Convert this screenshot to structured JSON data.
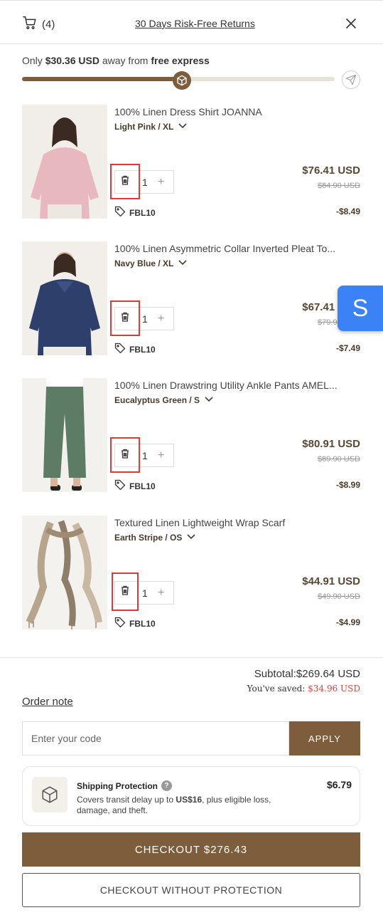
{
  "header": {
    "cart_count": "(4)",
    "returns_link": "30 Days Risk-Free Returns"
  },
  "shipping": {
    "prefix": "Only",
    "amount": "$30.36 USD",
    "middle": "away from",
    "goal": "free express",
    "progress_fraction": 0.51
  },
  "items": [
    {
      "title": "100% Linen Dress Shirt JOANNA",
      "variant": "Light Pink / XL",
      "qty": "1",
      "price": "$76.41 USD",
      "old_price": "$84.90 USD",
      "code": "FBL10",
      "discount": "-$8.49",
      "color": "#e7b8be"
    },
    {
      "title": "100% Linen Asymmetric Collar Inverted Pleat To...",
      "variant": "Navy Blue / XL",
      "qty": "1",
      "price": "$67.41 USD",
      "old_price": "$79.90 USD",
      "code": "FBL10",
      "discount": "-$7.49",
      "color": "#2e3f6b"
    },
    {
      "title": "100% Linen Drawstring Utility Ankle Pants AMEL...",
      "variant": "Eucalyptus Green / S",
      "qty": "1",
      "price": "$80.91 USD",
      "old_price": "$89.90 USD",
      "code": "FBL10",
      "discount": "-$8.99",
      "color": "#5d7c66"
    },
    {
      "title": "Textured Linen Lightweight Wrap Scarf",
      "variant": "Earth Stripe / OS",
      "qty": "1",
      "price": "$44.91 USD",
      "old_price": "$49.90 USD",
      "code": "FBL10",
      "discount": "-$4.99",
      "color": "#b7a48c"
    }
  ],
  "floating_badge": "S",
  "summary": {
    "subtotal": "Subtotal:$269.64 USD",
    "saved_label": "You've saved:",
    "saved_amount": "$34.96 USD"
  },
  "order_note": "Order note",
  "discount_code": {
    "placeholder": "Enter your code",
    "value": "",
    "apply_label": "APPLY"
  },
  "protection": {
    "title": "Shipping Protection",
    "desc_pre": "Covers transit delay up to",
    "desc_amount": "US$16",
    "desc_post": ", plus eligible loss, damage, and theft.",
    "price": "$6.79"
  },
  "checkout_label": "CHECKOUT $276.43",
  "checkout_no_protection_label": "CHECKOUT WITHOUT PROTECTION",
  "colors": {
    "brand": "#7d5d3b",
    "highlight_box": "#e53935",
    "saved_red": "#e0443a",
    "float_blue": "#3b82f6"
  }
}
